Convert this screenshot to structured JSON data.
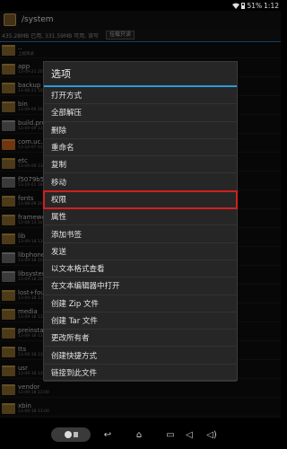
{
  "status": {
    "battery": "51%",
    "time": "1:12"
  },
  "app": {
    "title": "/system"
  },
  "info": {
    "storage": "435.28MB 已用, 331.59MB 可用, 读写",
    "button": "挂载只读"
  },
  "files": [
    {
      "name": "..",
      "date": "上级目录",
      "type": "up"
    },
    {
      "name": "app",
      "date": "13-09-21 20:00",
      "type": "folder"
    },
    {
      "name": "backup",
      "date": "13-08-21 10:03",
      "type": "folder"
    },
    {
      "name": "bin",
      "date": "13-09-09 20:00",
      "type": "folder"
    },
    {
      "name": "build.prop",
      "date": "13-09-09 13:00",
      "type": "file"
    },
    {
      "name": "com.uc.b",
      "date": "13-10-07 01:00",
      "type": "orange"
    },
    {
      "name": "etc",
      "date": "13-09-09 13:00",
      "type": "folder"
    },
    {
      "name": "f5079b51",
      "date": "13-10-01 18:00",
      "type": "file"
    },
    {
      "name": "fonts",
      "date": "13-08-09 20:00",
      "type": "folder"
    },
    {
      "name": "framewor",
      "date": "13-08-13 10:01",
      "type": "folder"
    },
    {
      "name": "lib",
      "date": "13-09-18 13:00",
      "type": "folder"
    },
    {
      "name": "libphonet",
      "date": "13-09-18 20:00",
      "type": "file"
    },
    {
      "name": "libsystem",
      "date": "13-09-18 20:00",
      "type": "file"
    },
    {
      "name": "lost+found",
      "date": "13-09-18 13:00",
      "type": "folder"
    },
    {
      "name": "media",
      "date": "13-09-18 13:00",
      "type": "folder"
    },
    {
      "name": "preinstall",
      "date": "13-09-18 13:00",
      "type": "folder"
    },
    {
      "name": "tts",
      "date": "13-09-18 13:00",
      "type": "folder"
    },
    {
      "name": "usr",
      "date": "13-09-18 13:00",
      "type": "folder"
    },
    {
      "name": "vendor",
      "date": "13-09-18 13:00",
      "type": "folder"
    },
    {
      "name": "xbin",
      "date": "13-09-18 13:00",
      "type": "folder"
    }
  ],
  "dialog": {
    "title": "选项",
    "items": [
      "打开方式",
      "全部解压",
      "删除",
      "重命名",
      "复制",
      "移动",
      "权限",
      "属性",
      "添加书签",
      "发送",
      "以文本格式查看",
      "在文本编辑器中打开",
      "创建 Zip 文件",
      "创建 Tar 文件",
      "更改所有者",
      "创建快捷方式",
      "链接到此文件"
    ],
    "highlighted_index": 6
  },
  "nav": {
    "back": "↩",
    "home": "⌂",
    "recent": "▭",
    "vol_down": "◁",
    "vol_up": "◁)"
  },
  "colors": {
    "accent": "#2b9ad9",
    "highlight": "#d21f1f"
  }
}
